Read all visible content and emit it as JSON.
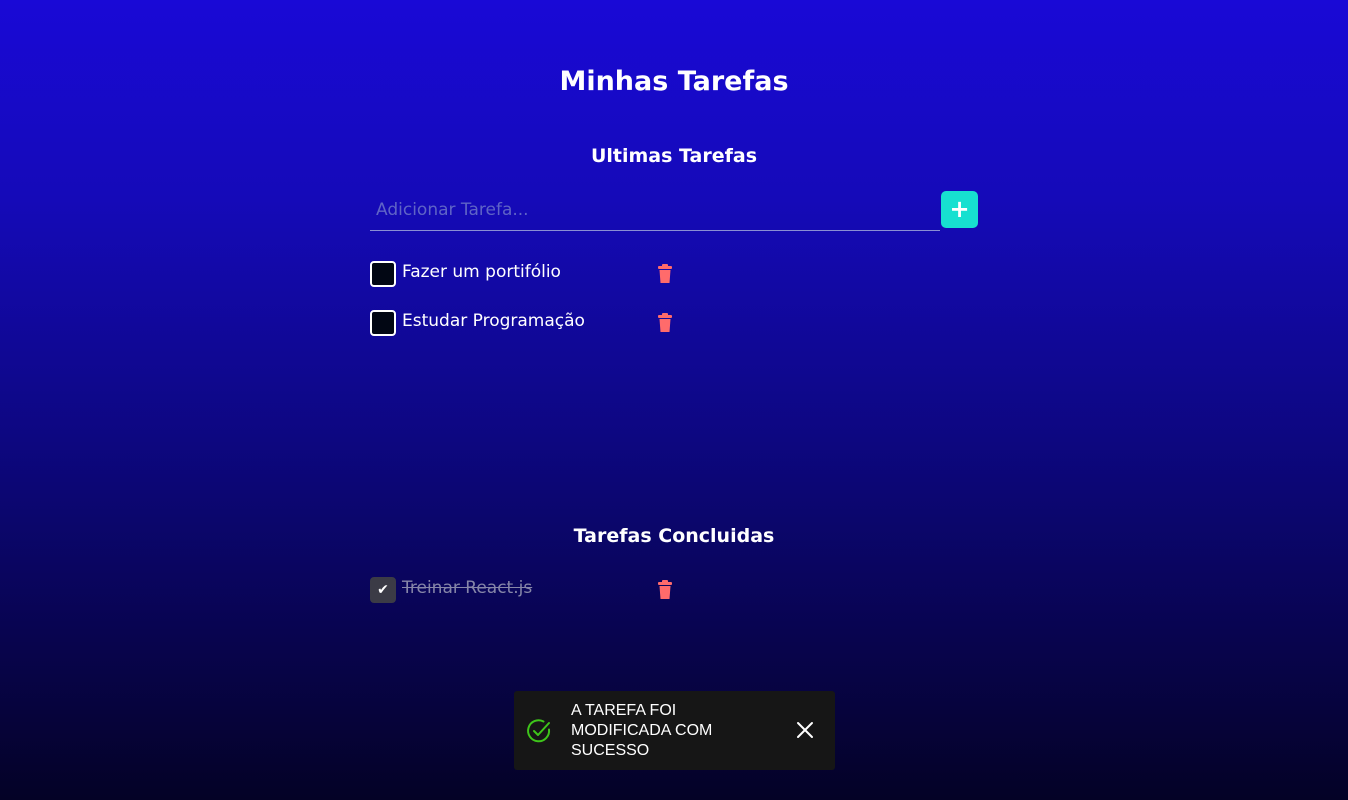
{
  "page": {
    "title": "Minhas Tarefas"
  },
  "pending_section": {
    "title": "Ultimas Tarefas",
    "input": {
      "value": "",
      "placeholder": "Adicionar Tarefa..."
    },
    "add_button_label": "+",
    "tasks": [
      {
        "label": "Fazer um portifólio",
        "checked": false
      },
      {
        "label": "Estudar Programação",
        "checked": false
      }
    ]
  },
  "done_section": {
    "title": "Tarefas Concluidas",
    "tasks": [
      {
        "label": "Treinar React.js",
        "checked": true,
        "check_glyph": "✔"
      }
    ]
  },
  "toast": {
    "message": "A TAREFA FOI MODIFICADA COM SUCESSO",
    "icon": "check-circle-icon",
    "close_icon": "close-icon"
  },
  "colors": {
    "accent": "#17e0d0",
    "trash": "#ff6b6b",
    "success": "#3ec51a",
    "toast_bg": "#161616",
    "done_text": "#8686a8"
  }
}
